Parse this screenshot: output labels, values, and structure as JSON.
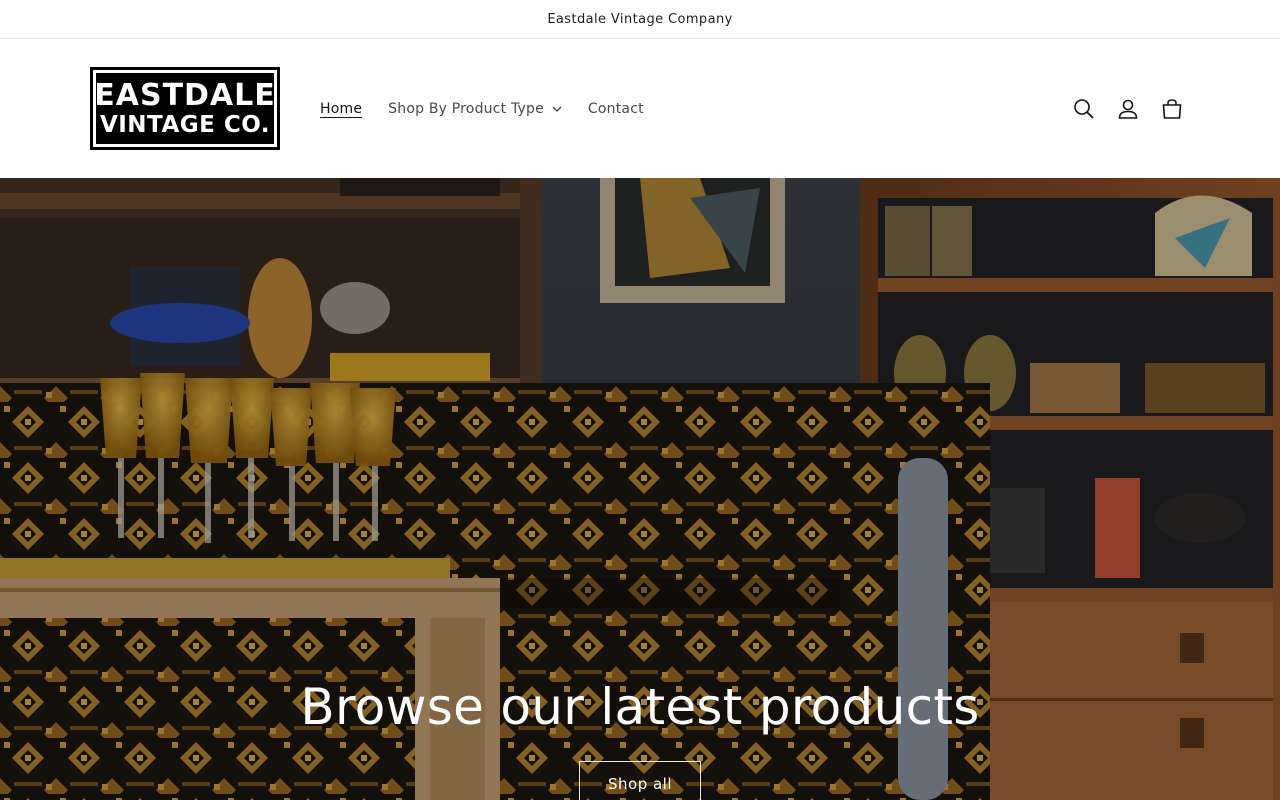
{
  "announcement": {
    "text": "Eastdale Vintage Company"
  },
  "logo": {
    "line1": "EASTDALE",
    "line2": "VINTAGE CO."
  },
  "nav": {
    "items": [
      {
        "label": "Home",
        "active": true
      },
      {
        "label": "Shop By Product Type",
        "has_dropdown": true
      },
      {
        "label": "Contact"
      }
    ]
  },
  "header_icons": [
    "search-icon",
    "account-icon",
    "cart-icon"
  ],
  "hero": {
    "title": "Browse our latest products",
    "button_label": "Shop all"
  },
  "colors": {
    "text": "#121212",
    "nav_text": "#4a4a4a",
    "hero_overlay": "rgba(0,0,0,0.28)",
    "wall": "#3b3d44",
    "wood": "#8a4f2a",
    "fabric_gold": "#b8862e"
  }
}
